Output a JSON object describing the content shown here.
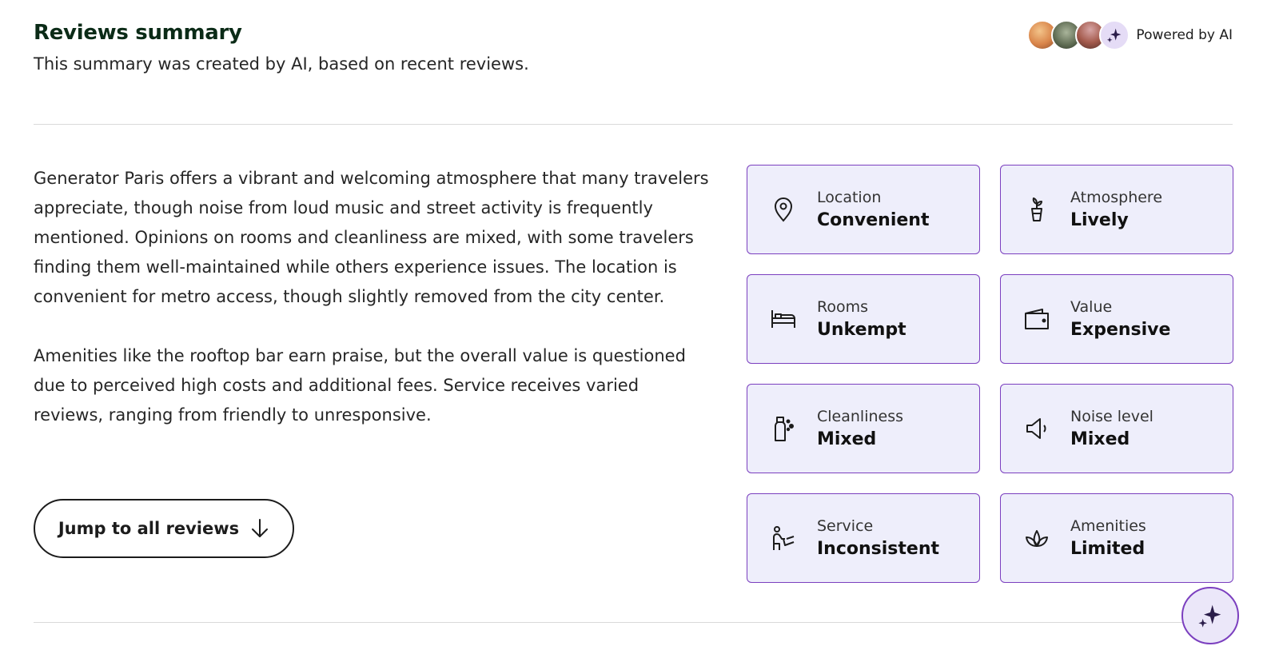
{
  "header": {
    "title": "Reviews summary",
    "subtitle": "This summary was created by AI, based on recent reviews."
  },
  "powered": {
    "label": "Powered by AI",
    "avatars": [
      "traveler-photo-avatar",
      "traveler-photo-avatar",
      "traveler-photo-avatar",
      "sparkle-icon"
    ]
  },
  "summary": {
    "paragraphs": [
      "Generator Paris offers a vibrant and welcoming atmosphere that many travelers appreciate, though noise from loud music and street activity is frequently mentioned. Opinions on rooms and cleanliness are mixed, with some travelers finding them well-maintained while others experience issues. The location is convenient for metro access, though slightly removed from the city center.",
      "Amenities like the rooftop bar earn praise, but the overall value is questioned due to perceived high costs and additional fees. Service receives varied reviews, ranging from friendly to unresponsive."
    ]
  },
  "jump_button": {
    "label": "Jump to all reviews",
    "icon": "arrow-down-icon"
  },
  "cards": [
    {
      "label": "Location",
      "value": "Convenient",
      "icon": "location-pin-icon"
    },
    {
      "label": "Atmosphere",
      "value": "Lively",
      "icon": "plant-pot-icon"
    },
    {
      "label": "Rooms",
      "value": "Unkempt",
      "icon": "bed-icon"
    },
    {
      "label": "Value",
      "value": "Expensive",
      "icon": "wallet-icon"
    },
    {
      "label": "Cleanliness",
      "value": "Mixed",
      "icon": "spray-bottle-icon"
    },
    {
      "label": "Noise level",
      "value": "Mixed",
      "icon": "speaker-icon"
    },
    {
      "label": "Service",
      "value": "Inconsistent",
      "icon": "concierge-icon"
    },
    {
      "label": "Amenities",
      "value": "Limited",
      "icon": "lotus-icon"
    }
  ],
  "fab": {
    "icon": "sparkle-icon"
  },
  "colors": {
    "accent": "#7b3fbf",
    "card_bg": "#eeeefb",
    "title": "#0b2b17"
  }
}
